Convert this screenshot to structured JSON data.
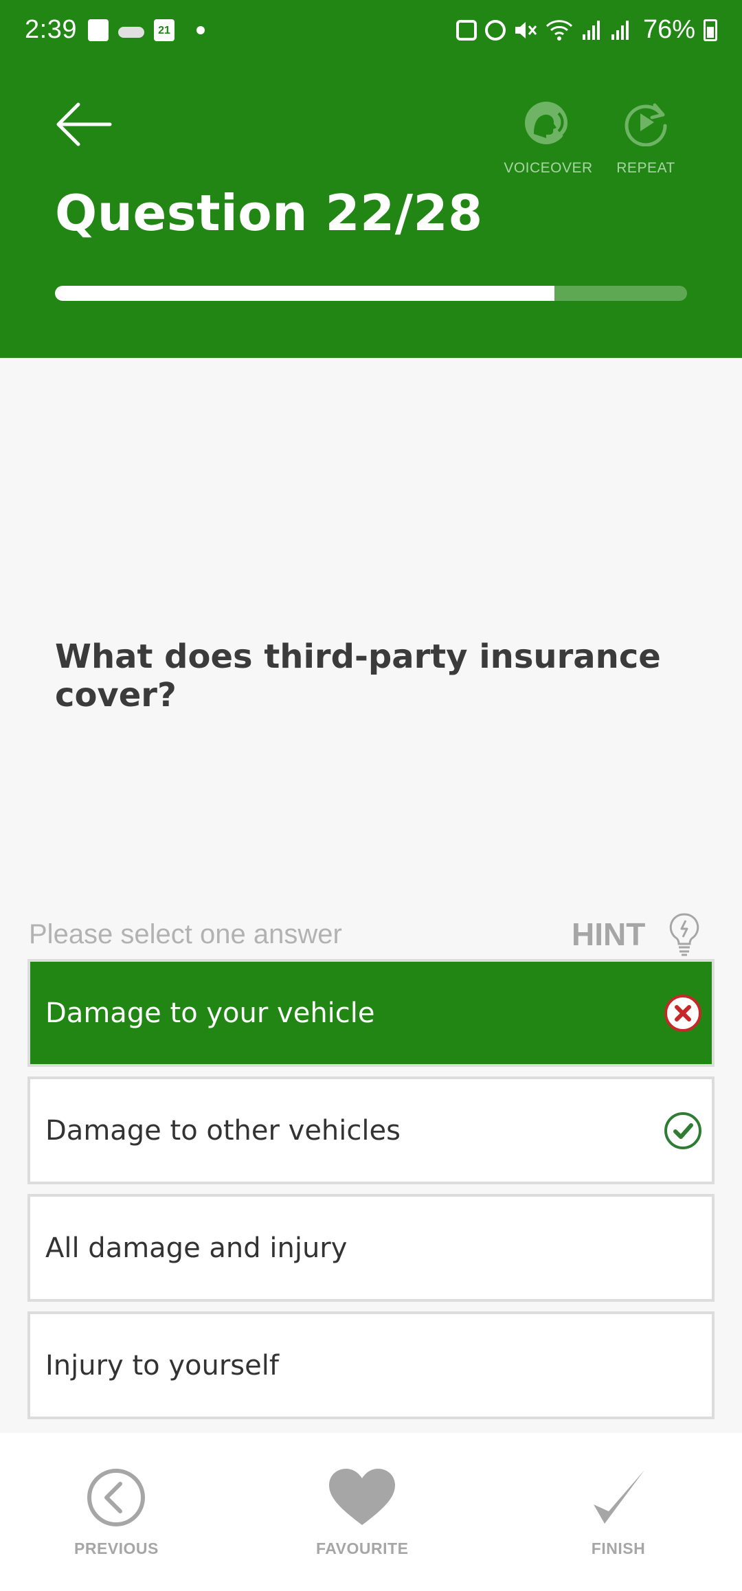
{
  "status_bar": {
    "time": "2:39",
    "calendar_day": "21",
    "battery": "76%"
  },
  "header": {
    "title": "Question 22/28",
    "voiceover_label": "VOICEOVER",
    "repeat_label": "REPEAT",
    "progress": {
      "current": 22,
      "total": 28,
      "fraction": 0.79
    }
  },
  "question": {
    "text": "What does third-party insurance cover?",
    "prompt": "Please select one answer",
    "hint_label": "HINT"
  },
  "answers": [
    {
      "label": "Damage to your vehicle",
      "selected": true,
      "mark": "x-circle-icon"
    },
    {
      "label": "Damage to other vehicles",
      "selected": false,
      "mark": "check-circle-icon"
    },
    {
      "label": "All damage and injury",
      "selected": false,
      "mark": null
    },
    {
      "label": "Injury to yourself",
      "selected": false,
      "mark": null
    }
  ],
  "bottom_nav": {
    "previous_label": "PREVIOUS",
    "favourite_label": "FAVOURITE",
    "finish_label": "FINISH"
  },
  "colors": {
    "brand_green": "#218614",
    "progress_track": "#5ea853",
    "wrong_red": "#c62828",
    "correct_green": "#2e7d32",
    "muted_gray": "#a6a6a6"
  }
}
